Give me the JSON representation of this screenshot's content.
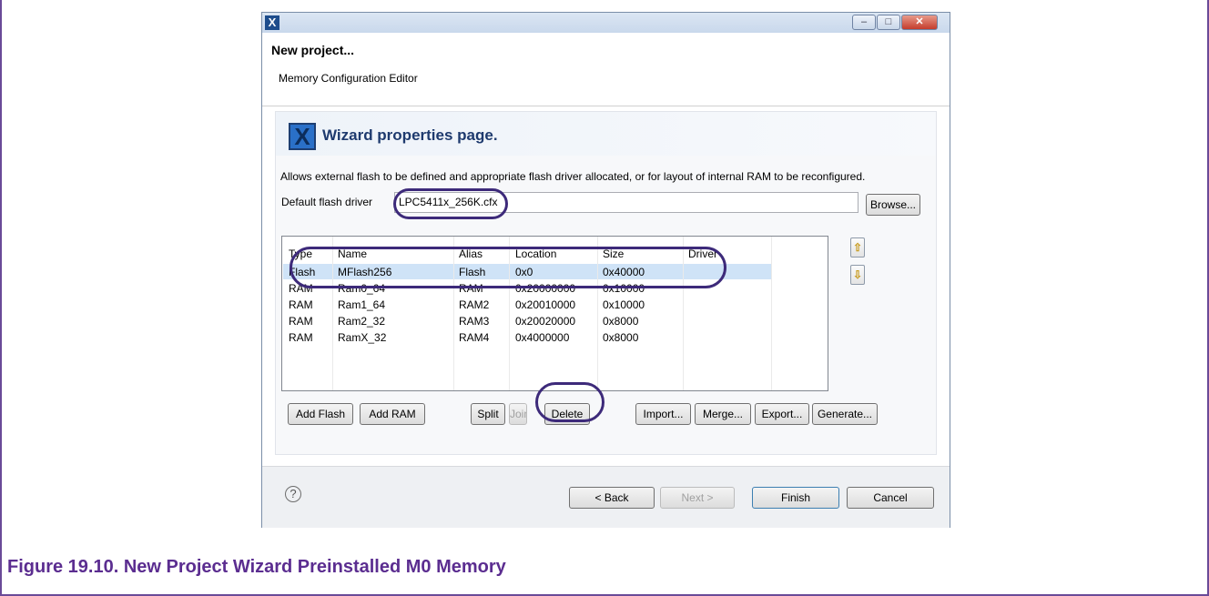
{
  "dialog": {
    "title_icon": "x-app-icon",
    "controls": {
      "minimize": "‒",
      "maximize": "□",
      "close": "✕"
    }
  },
  "header": {
    "title": "New project...",
    "subtitle": "Memory Configuration Editor"
  },
  "wizard": {
    "title": "Wizard properties page.",
    "description": "Allows external flash to be defined and appropriate flash driver allocated, or for layout of internal RAM to be reconfigured.",
    "flash_driver_label": "Default flash driver",
    "flash_driver_value": "LPC5411x_256K.cfx",
    "browse_label": "Browse..."
  },
  "table": {
    "columns": [
      "Type",
      "Name",
      "Alias",
      "Location",
      "Size",
      "Driver"
    ],
    "rows": [
      [
        "Flash",
        "MFlash256",
        "Flash",
        "0x0",
        "0x40000",
        ""
      ],
      [
        "RAM",
        "Ram0_64",
        "RAM",
        "0x20000000",
        "0x10000",
        ""
      ],
      [
        "RAM",
        "Ram1_64",
        "RAM2",
        "0x20010000",
        "0x10000",
        ""
      ],
      [
        "RAM",
        "Ram2_32",
        "RAM3",
        "0x20020000",
        "0x8000",
        ""
      ],
      [
        "RAM",
        "RamX_32",
        "RAM4",
        "0x4000000",
        "0x8000",
        ""
      ]
    ]
  },
  "buttons": {
    "add_flash": "Add Flash",
    "add_ram": "Add RAM",
    "split": "Split",
    "join": "Join",
    "delete": "Delete",
    "import": "Import...",
    "merge": "Merge...",
    "export": "Export...",
    "generate": "Generate..."
  },
  "footer": {
    "help": "?",
    "back": "< Back",
    "next": "Next >",
    "finish": "Finish",
    "cancel": "Cancel"
  },
  "caption": "Figure 19.10. New Project Wizard Preinstalled M0 Memory",
  "colors": {
    "caption": "#5b2d90",
    "annotation_circle": "#3d2a7a",
    "selected_row": "#cfe3f7"
  }
}
